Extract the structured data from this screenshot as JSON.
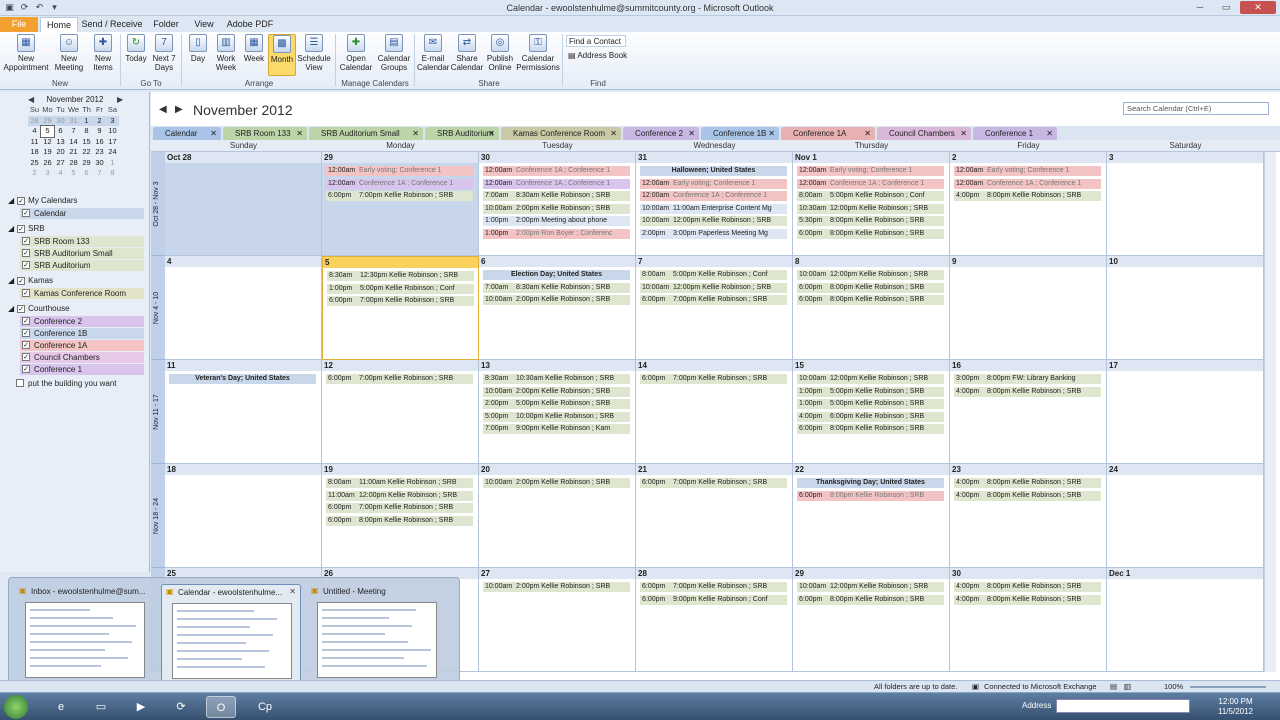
{
  "window": {
    "title": "Calendar - ewoolstenhulme@summitcounty.org - Microsoft Outlook"
  },
  "ribbon_tabs": [
    "File",
    "Home",
    "Send / Receive",
    "Folder",
    "View",
    "Adobe PDF"
  ],
  "ribbon": {
    "buttons": [
      {
        "label": "New Appointment",
        "icon": "calendar-icon"
      },
      {
        "label": "New Meeting",
        "icon": "meeting-icon"
      },
      {
        "label": "New Items",
        "icon": "items-icon"
      },
      {
        "label": "Today",
        "icon": "go-today-icon"
      },
      {
        "label": "Next 7 Days",
        "icon": "next7-icon"
      },
      {
        "label": "Day",
        "icon": "day-icon"
      },
      {
        "label": "Work Week",
        "icon": "workweek-icon"
      },
      {
        "label": "Week",
        "icon": "week-icon"
      },
      {
        "label": "Month",
        "icon": "month-icon"
      },
      {
        "label": "Schedule View",
        "icon": "schedule-icon"
      },
      {
        "label": "Open Calendar",
        "icon": "open-calendar-icon"
      },
      {
        "label": "Calendar Groups",
        "icon": "groups-icon"
      },
      {
        "label": "E-mail Calendar",
        "icon": "email-icon"
      },
      {
        "label": "Share Calendar",
        "icon": "share-icon"
      },
      {
        "label": "Publish Online",
        "icon": "publish-icon"
      },
      {
        "label": "Calendar Permissions",
        "icon": "permissions-icon"
      }
    ],
    "groups": [
      "New",
      "Go To",
      "Arrange",
      "Manage Calendars",
      "Share",
      "Find"
    ],
    "find_contact": "Find a Contact",
    "address_book": "Address Book"
  },
  "mini_calendar": {
    "title": "November 2012",
    "weekdays": [
      "Su",
      "Mo",
      "Tu",
      "We",
      "Th",
      "Fr",
      "Sa"
    ],
    "weeks": [
      [
        "28",
        "29",
        "30",
        "31",
        "1",
        "2",
        "3"
      ],
      [
        "4",
        "5",
        "6",
        "7",
        "8",
        "9",
        "10"
      ],
      [
        "11",
        "12",
        "13",
        "14",
        "15",
        "16",
        "17"
      ],
      [
        "18",
        "19",
        "20",
        "21",
        "22",
        "23",
        "24"
      ],
      [
        "25",
        "26",
        "27",
        "28",
        "29",
        "30",
        "1"
      ],
      [
        "2",
        "3",
        "4",
        "5",
        "6",
        "7",
        "8"
      ]
    ]
  },
  "nav": {
    "sections": [
      {
        "name": "My Calendars",
        "items": [
          "Calendar"
        ]
      },
      {
        "name": "SRB",
        "items": [
          "SRB Room 133",
          "SRB Auditorium Small",
          "SRB Auditorium"
        ]
      },
      {
        "name": "Kamas",
        "items": [
          "Kamas Conference Room"
        ]
      },
      {
        "name": "Courthouse",
        "items": [
          "Conference 2",
          "Conference 1B",
          "Conference 1A",
          "Council Chambers",
          "Conference 1"
        ]
      }
    ],
    "extra": "put the building you want"
  },
  "previews": [
    {
      "title": "Inbox - ewoolstenhulme@sum..."
    },
    {
      "title": "Calendar - ewoolstenhulme..."
    },
    {
      "title": "Untitled - Meeting"
    }
  ],
  "main": {
    "title": "November 2012",
    "search_placeholder": "Search Calendar (Ctrl+E)",
    "cal_tabs": [
      "Calendar",
      "SRB Room 133",
      "SRB Auditorium Small",
      "SRB Auditorium",
      "Kamas Conference Room",
      "Conference 2",
      "Conference 1B",
      "Conference 1A",
      "Council Chambers",
      "Conference 1"
    ],
    "tab_colors": [
      "#a9c4e6",
      "#bcd5a8",
      "#bcd5a8",
      "#bcd5a8",
      "#c9c9a6",
      "#c7b7e3",
      "#a9c4e6",
      "#e8b0b0",
      "#d8b7d8",
      "#c7b7e3"
    ],
    "days": [
      "Sunday",
      "Monday",
      "Tuesday",
      "Wednesday",
      "Thursday",
      "Friday",
      "Saturday"
    ],
    "week_labels": [
      "Oct 28 - Nov 3",
      "Nov 4 - 10",
      "Nov 11 - 17",
      "Nov 18 - 24",
      ""
    ],
    "weeks": [
      [
        {
          "d": "Oct 28",
          "blue": true,
          "ev": []
        },
        {
          "d": "29",
          "blue": true,
          "ev": [
            [
              "12:00am",
              "Early voting; Conference 1",
              "#f4c4c4",
              true
            ],
            [
              "12:00am",
              "Conference 1A ; Conference 1",
              "#d8c4ec",
              true
            ],
            [
              "6:00pm",
              "7:00pm Kellie Robinson ; SRB",
              "#dfe6d0",
              false
            ]
          ]
        },
        {
          "d": "30",
          "blue": false,
          "ev": [
            [
              "12:00am",
              "Conference 1A ; Conference 1",
              "#f4c4c4",
              true
            ],
            [
              "12:00am",
              "Conference 1A ; Conference 1",
              "#d8c4ec",
              true
            ],
            [
              "7:00am",
              "8:30am Kellie Robinson ; SRB",
              "#dfe6d0",
              false
            ],
            [
              "10:00am",
              "2:00pm Kellie Robinson ; SRB",
              "#dfe6d0",
              false
            ],
            [
              "1:00pm",
              "2:00pm Meeting about phone",
              "#dde6f2",
              false
            ],
            [
              "1:00pm",
              "2:00pm Ron Boyer ; Conferenc",
              "#f4c4c4",
              true
            ]
          ]
        },
        {
          "d": "31",
          "blue": false,
          "ev": [
            [
              "",
              "Halloween; United States",
              "#c9d7ea",
              false,
              true
            ],
            [
              "12:00am",
              "Early voting; Conference 1",
              "#f4c4c4",
              true
            ],
            [
              "12:00am",
              "Conference 1A ; Conference 1",
              "#f4c4c4",
              true
            ],
            [
              "10:00am",
              "11:00am Enterprise Content Mg",
              "#dde6f2",
              false
            ],
            [
              "10:00am",
              "12:00pm Kellie Robinson ; SRB",
              "#dfe6d0",
              false
            ],
            [
              "2:00pm",
              "3:00pm Paperless Meeting Mg",
              "#dde6f2",
              false
            ]
          ]
        },
        {
          "d": "Nov 1",
          "blue": false,
          "ev": [
            [
              "12:00am",
              "Early voting; Conference 1",
              "#f4c4c4",
              true
            ],
            [
              "12:00am",
              "Conference 1A ; Conference 1",
              "#f4c4c4",
              true
            ],
            [
              "8:00am",
              "5:00pm Kellie Robinson ; Conf",
              "#dfe6d0",
              false
            ],
            [
              "10:30am",
              "12:00pm Kellie Robinson ; SRB",
              "#dfe6d0",
              false
            ],
            [
              "5:30pm",
              "8:00pm Kellie Robinson ; SRB",
              "#dfe6d0",
              false
            ],
            [
              "6:00pm",
              "8:00pm Kellie Robinson ; SRB",
              "#dfe6d0",
              false
            ]
          ]
        },
        {
          "d": "2",
          "blue": false,
          "ev": [
            [
              "12:00am",
              "Early voting; Conference 1",
              "#f4c4c4",
              true
            ],
            [
              "12:00am",
              "Conference 1A ; Conference 1",
              "#f4c4c4",
              true
            ],
            [
              "4:00pm",
              "8:00pm Kellie Robinson ; SRB",
              "#dfe6d0",
              false
            ]
          ]
        },
        {
          "d": "3",
          "blue": false,
          "ev": []
        }
      ],
      [
        {
          "d": "4",
          "blue": false,
          "ev": []
        },
        {
          "d": "5",
          "blue": false,
          "today": true,
          "ev": [
            [
              "8:30am",
              "12:30pm Kellie Robinson ; SRB",
              "#dfe6d0",
              false
            ],
            [
              "1:00pm",
              "5:00pm Kellie Robinson ; Conf",
              "#dfe6d0",
              false
            ],
            [
              "6:00pm",
              "7:00pm Kellie Robinson ; SRB",
              "#dfe6d0",
              false
            ]
          ]
        },
        {
          "d": "6",
          "blue": false,
          "ev": [
            [
              "",
              "Election Day; United States",
              "#c9d7ea",
              false,
              true
            ],
            [
              "7:00am",
              "8:30am Kellie Robinson ; SRB",
              "#dfe6d0",
              false
            ],
            [
              "10:00am",
              "2:00pm Kellie Robinson ; SRB",
              "#dfe6d0",
              false
            ]
          ]
        },
        {
          "d": "7",
          "blue": false,
          "ev": [
            [
              "8:00am",
              "5:00pm Kellie Robinson ; Conf",
              "#dfe6d0",
              false
            ],
            [
              "10:00am",
              "12:00pm Kellie Robinson ; SRB",
              "#dfe6d0",
              false
            ],
            [
              "6:00pm",
              "7:00pm Kellie Robinson ; SRB",
              "#dfe6d0",
              false
            ]
          ]
        },
        {
          "d": "8",
          "blue": false,
          "ev": [
            [
              "10:00am",
              "12:00pm Kellie Robinson ; SRB",
              "#dfe6d0",
              false
            ],
            [
              "6:00pm",
              "8:00pm Kellie Robinson ; SRB",
              "#dfe6d0",
              false
            ],
            [
              "6:00pm",
              "8:00pm Kellie Robinson ; SRB",
              "#dfe6d0",
              false
            ]
          ]
        },
        {
          "d": "9",
          "blue": false,
          "ev": []
        },
        {
          "d": "10",
          "blue": false,
          "ev": []
        }
      ],
      [
        {
          "d": "11",
          "blue": false,
          "ev": [
            [
              "",
              "Veteran's Day; United States",
              "#c9d7ea",
              false,
              true
            ]
          ]
        },
        {
          "d": "12",
          "blue": false,
          "ev": [
            [
              "6:00pm",
              "7:00pm Kellie Robinson ; SRB",
              "#dfe6d0",
              false
            ]
          ]
        },
        {
          "d": "13",
          "blue": false,
          "ev": [
            [
              "8:30am",
              "10:30am Kellie Robinson ; SRB",
              "#dfe6d0",
              false
            ],
            [
              "10:00am",
              "2:00pm Kellie Robinson ; SRB",
              "#dfe6d0",
              false
            ],
            [
              "2:00pm",
              "5:00pm Kellie Robinson ; SRB",
              "#dfe6d0",
              false
            ],
            [
              "5:00pm",
              "10:00pm Kellie Robinson ; SRB",
              "#dfe6d0",
              false
            ],
            [
              "7:00pm",
              "9:00pm Kellie Robinson ; Kam",
              "#dfe6d0",
              false
            ]
          ]
        },
        {
          "d": "14",
          "blue": false,
          "ev": [
            [
              "6:00pm",
              "7:00pm Kellie Robinson ; SRB",
              "#dfe6d0",
              false
            ]
          ]
        },
        {
          "d": "15",
          "blue": false,
          "ev": [
            [
              "10:00am",
              "12:00pm Kellie Robinson ; SRB",
              "#dfe6d0",
              false
            ],
            [
              "1:00pm",
              "5:00pm Kellie Robinson ; SRB",
              "#dfe6d0",
              false
            ],
            [
              "1:00pm",
              "5:00pm Kellie Robinson ; SRB",
              "#dfe6d0",
              false
            ],
            [
              "4:00pm",
              "6:00pm Kellie Robinson ; SRB",
              "#dfe6d0",
              false
            ],
            [
              "6:00pm",
              "8:00pm Kellie Robinson ; SRB",
              "#dfe6d0",
              false
            ]
          ]
        },
        {
          "d": "16",
          "blue": false,
          "ev": [
            [
              "3:00pm",
              "8:00pm FW: Library Banking",
              "#dfe6d0",
              false
            ],
            [
              "4:00pm",
              "8:00pm Kellie Robinson ; SRB",
              "#dfe6d0",
              false
            ]
          ]
        },
        {
          "d": "17",
          "blue": false,
          "ev": []
        }
      ],
      [
        {
          "d": "18",
          "blue": false,
          "ev": []
        },
        {
          "d": "19",
          "blue": false,
          "ev": [
            [
              "8:00am",
              "11:00am Kellie Robinson ; SRB",
              "#dfe6d0",
              false
            ],
            [
              "11:00am",
              "12:00pm Kellie Robinson ; SRB",
              "#dfe6d0",
              false
            ],
            [
              "6:00pm",
              "7:00pm Kellie Robinson ; SRB",
              "#dfe6d0",
              false
            ],
            [
              "6:00pm",
              "8:00pm Kellie Robinson ; SRB",
              "#dfe6d0",
              false
            ]
          ]
        },
        {
          "d": "20",
          "blue": false,
          "ev": [
            [
              "10:00am",
              "2:00pm Kellie Robinson ; SRB",
              "#dfe6d0",
              false
            ]
          ]
        },
        {
          "d": "21",
          "blue": false,
          "ev": [
            [
              "6:00pm",
              "7:00pm Kellie Robinson ; SRB",
              "#dfe6d0",
              false
            ]
          ]
        },
        {
          "d": "22",
          "blue": false,
          "ev": [
            [
              "",
              "Thanksgiving Day; United States",
              "#c9d7ea",
              false,
              true
            ],
            [
              "6:00pm",
              "8:00pm Kellie Robinson ; SRB",
              "#f4c4c4",
              true
            ]
          ]
        },
        {
          "d": "23",
          "blue": false,
          "ev": [
            [
              "4:00pm",
              "8:00pm Kellie Robinson ; SRB",
              "#dfe6d0",
              false
            ],
            [
              "4:00pm",
              "8:00pm Kellie Robinson ; SRB",
              "#dfe6d0",
              false
            ]
          ]
        },
        {
          "d": "24",
          "blue": false,
          "ev": []
        }
      ],
      [
        {
          "d": "25",
          "blue": false,
          "ev": []
        },
        {
          "d": "26",
          "blue": false,
          "ev": []
        },
        {
          "d": "27",
          "blue": false,
          "ev": [
            [
              "10:00am",
              "2:00pm Kellie Robinson ; SRB",
              "#dfe6d0",
              false
            ]
          ]
        },
        {
          "d": "28",
          "blue": false,
          "ev": [
            [
              "6:00pm",
              "7:00pm Kellie Robinson ; SRB",
              "#dfe6d0",
              false
            ],
            [
              "6:00pm",
              "9:00pm Kellie Robinson ; Conf",
              "#dfe6d0",
              false
            ]
          ]
        },
        {
          "d": "29",
          "blue": false,
          "ev": [
            [
              "10:00am",
              "12:00pm Kellie Robinson ; SRB",
              "#dfe6d0",
              false
            ],
            [
              "6:00pm",
              "8:00pm Kellie Robinson ; SRB",
              "#dfe6d0",
              false
            ]
          ]
        },
        {
          "d": "30",
          "blue": false,
          "ev": [
            [
              "4:00pm",
              "8:00pm Kellie Robinson ; SRB",
              "#dfe6d0",
              false
            ],
            [
              "4:00pm",
              "8:00pm Kellie Robinson ; SRB",
              "#dfe6d0",
              false
            ]
          ]
        },
        {
          "d": "Dec 1",
          "blue": false,
          "ev": []
        }
      ]
    ]
  },
  "status": {
    "left": "All folders are up to date.",
    "exchange": "Connected to Microsoft Exchange",
    "zoom": "100%"
  },
  "taskbar": {
    "address_label": "Address",
    "time": "12:00 PM",
    "date": "11/5/2012"
  }
}
